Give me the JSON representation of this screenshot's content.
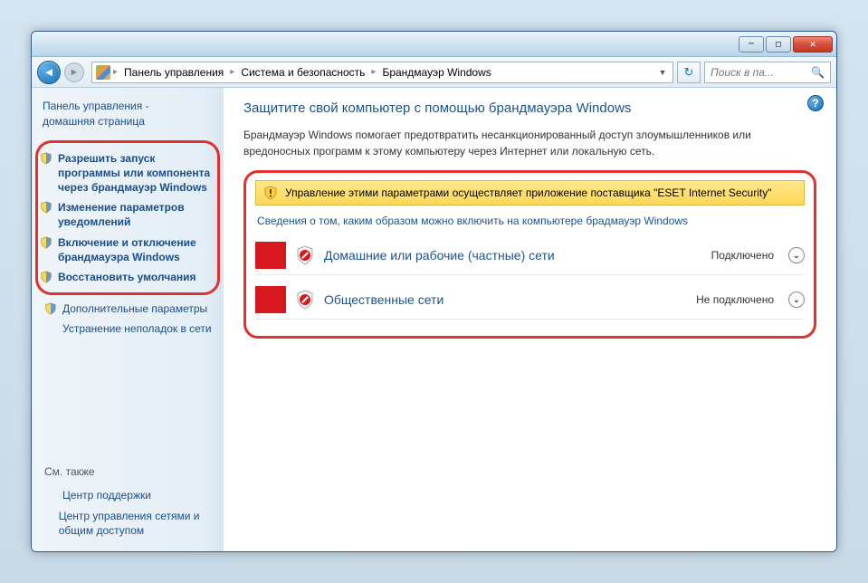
{
  "breadcrumb": {
    "items": [
      "Панель управления",
      "Система и безопасность",
      "Брандмауэр Windows"
    ]
  },
  "search": {
    "placeholder": "Поиск в па..."
  },
  "sidebar": {
    "home_line1": "Панель управления -",
    "home_line2": "домашняя страница",
    "links": [
      "Разрешить запуск программы или компонента через брандмауэр Windows",
      "Изменение параметров уведомлений",
      "Включение и отключение брандмауэра Windows",
      "Восстановить умолчания"
    ],
    "extra1": "Дополнительные параметры",
    "extra2": "Устранение неполадок в сети",
    "seealso_label": "См. также",
    "seealso1": "Центр поддержки",
    "seealso2": "Центр управления сетями и общим доступом"
  },
  "main": {
    "heading": "Защитите свой компьютер с помощью брандмауэра Windows",
    "desc": "Брандмауэр Windows помогает предотвратить несанкционированный доступ злоумышленников или вредоносных программ к этому компьютеру через Интернет или локальную сеть.",
    "warning": "Управление этими параметрами осуществляет приложение поставщика \"ESET Internet Security\"",
    "infolink": "Сведения о том, каким образом можно включить на компьютере брадмауэр Windows",
    "net1": {
      "name": "Домашние или рабочие (частные) сети",
      "status": "Подключено"
    },
    "net2": {
      "name": "Общественные сети",
      "status": "Не подключено"
    }
  }
}
